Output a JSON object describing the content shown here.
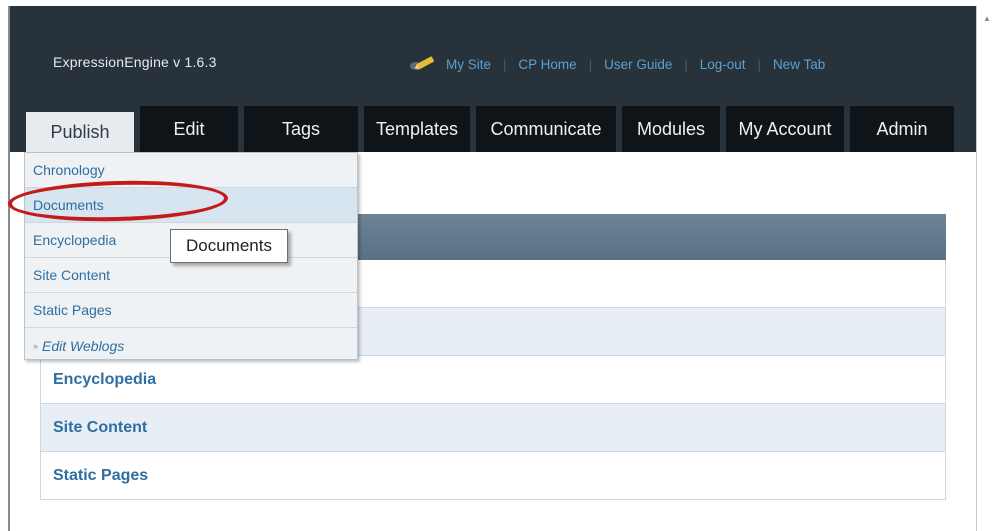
{
  "header": {
    "brand": "ExpressionEngine  v 1.6.3",
    "nav_links": [
      {
        "label": "My Site"
      },
      {
        "label": "CP Home"
      },
      {
        "label": "User Guide"
      },
      {
        "label": "Log-out"
      },
      {
        "label": "New Tab"
      }
    ]
  },
  "tabs": [
    {
      "label": "Publish",
      "active": true
    },
    {
      "label": "Edit"
    },
    {
      "label": "Tags"
    },
    {
      "label": "Templates"
    },
    {
      "label": "Communicate"
    },
    {
      "label": "Modules"
    },
    {
      "label": "My Account"
    },
    {
      "label": "Admin"
    }
  ],
  "publish_menu": {
    "items": [
      {
        "label": "Chronology"
      },
      {
        "label": "Documents",
        "hovered": true
      },
      {
        "label": "Encyclopedia"
      },
      {
        "label": "Site Content"
      },
      {
        "label": "Static Pages"
      }
    ],
    "edit_weblogs": "Edit Weblogs"
  },
  "tooltip": {
    "text": "Documents"
  },
  "weblog_list": {
    "rows": [
      {
        "label": "Encyclopedia"
      },
      {
        "label": "Site Content"
      },
      {
        "label": "Static Pages"
      }
    ]
  },
  "colors": {
    "header_bg": "#27323b",
    "tab_bg": "#0f1418",
    "link": "#2f6ea0",
    "highlight": "#c51a1a"
  }
}
